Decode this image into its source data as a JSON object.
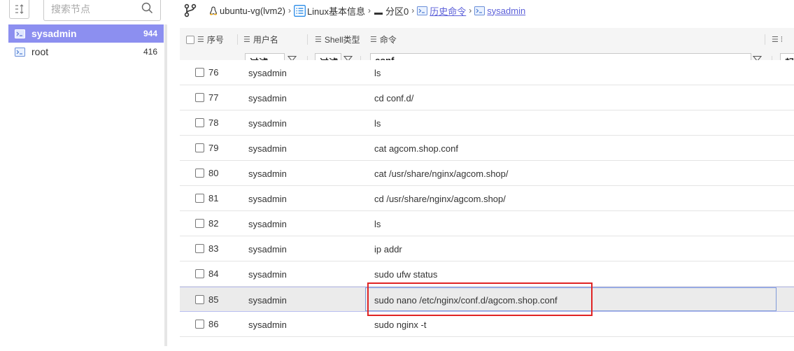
{
  "left_panel": {
    "search_placeholder": "搜索节点",
    "nodes": [
      {
        "label": "sysadmin",
        "count": "944",
        "selected": true
      },
      {
        "label": "root",
        "count": "416",
        "selected": false
      }
    ]
  },
  "breadcrumb": {
    "items": [
      {
        "label": "ubuntu-vg(lvm2)",
        "icon": "linux-icon"
      },
      {
        "label": "Linux基本信息",
        "icon": "list-icon"
      },
      {
        "label": "分区0",
        "icon": "partition-icon"
      },
      {
        "label": "历史命令",
        "icon": "terminal-icon"
      },
      {
        "label": "sysadmin",
        "icon": "terminal-icon"
      }
    ]
  },
  "table": {
    "headers": {
      "seq": "序号",
      "user": "用户名",
      "shell": "Shell类型",
      "command": "命令"
    },
    "filters": {
      "user": "过滤",
      "shell": "过滤",
      "command": "conf",
      "next": "起"
    },
    "rows": [
      {
        "seq": "76",
        "user": "sysadmin",
        "cmd": "ls"
      },
      {
        "seq": "77",
        "user": "sysadmin",
        "cmd": "cd conf.d/"
      },
      {
        "seq": "78",
        "user": "sysadmin",
        "cmd": "ls"
      },
      {
        "seq": "79",
        "user": "sysadmin",
        "cmd": "cat agcom.shop.conf"
      },
      {
        "seq": "80",
        "user": "sysadmin",
        "cmd": "cat /usr/share/nginx/agcom.shop/"
      },
      {
        "seq": "81",
        "user": "sysadmin",
        "cmd": "cd /usr/share/nginx/agcom.shop/"
      },
      {
        "seq": "82",
        "user": "sysadmin",
        "cmd": "ls"
      },
      {
        "seq": "83",
        "user": "sysadmin",
        "cmd": "ip addr"
      },
      {
        "seq": "84",
        "user": "sysadmin",
        "cmd": "sudo ufw status"
      },
      {
        "seq": "85",
        "user": "sysadmin",
        "cmd": "sudo nano /etc/nginx/conf.d/agcom.shop.conf",
        "selected": true
      },
      {
        "seq": "86",
        "user": "sysadmin",
        "cmd": "sudo nginx -t"
      }
    ]
  },
  "colors": {
    "accent": "#8c8ff0",
    "link": "#5b5fd9",
    "highlight_border": "#e02424"
  }
}
